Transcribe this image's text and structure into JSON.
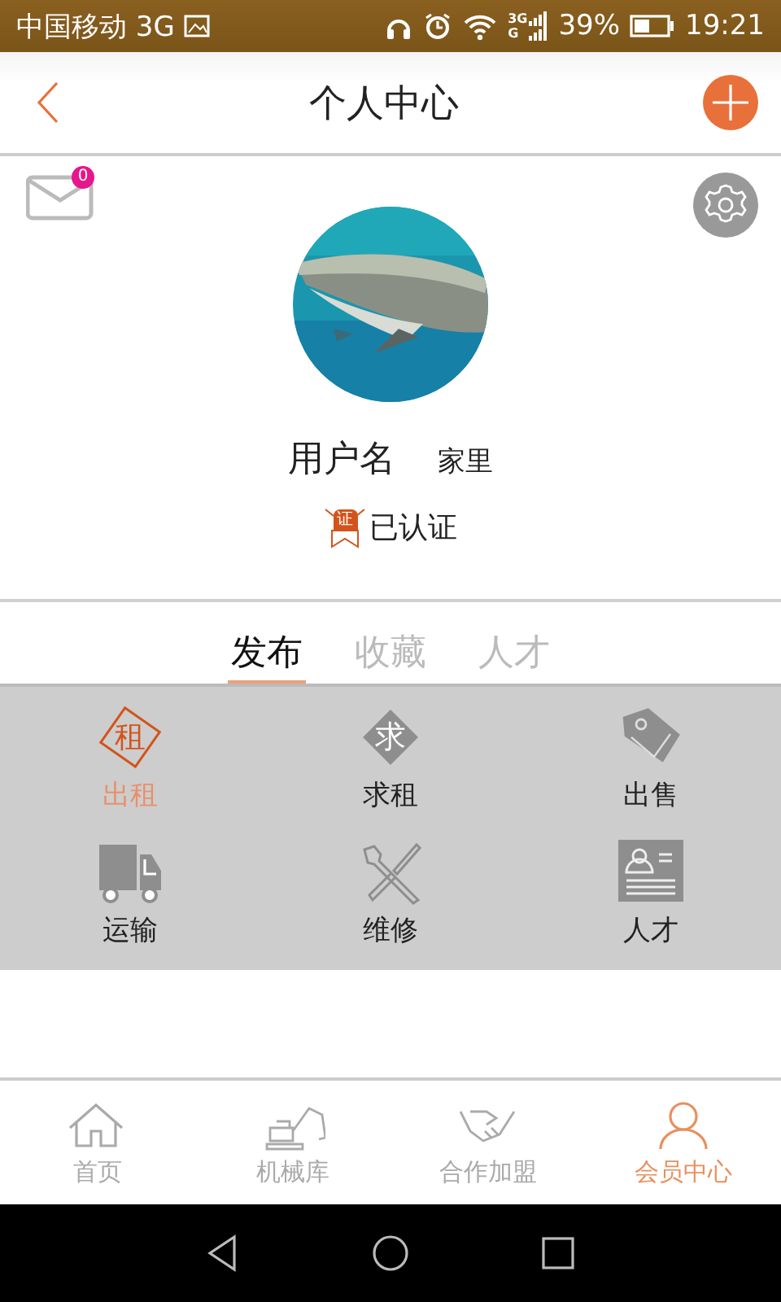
{
  "status_bar": {
    "carrier": "中国移动 3G",
    "network_labels": [
      "3G",
      "G"
    ],
    "battery": "39%",
    "time": "19:21"
  },
  "header": {
    "title": "个人中心"
  },
  "profile": {
    "message_count": "0",
    "username_label": "用户名",
    "username": "家里",
    "verified": true,
    "verified_glyph": "证",
    "verified_label": "已认证"
  },
  "tabs": [
    {
      "label": "发布",
      "selected": true
    },
    {
      "label": "收藏",
      "selected": false
    },
    {
      "label": "人才",
      "selected": false
    }
  ],
  "actions": [
    {
      "kind": "rent",
      "glyph": "租",
      "label": "出租",
      "selected": true
    },
    {
      "kind": "seek",
      "glyph": "求",
      "label": "求租",
      "selected": false
    },
    {
      "kind": "sale",
      "label": "出售",
      "selected": false
    },
    {
      "kind": "truck",
      "label": "运输",
      "selected": false
    },
    {
      "kind": "repair",
      "label": "维修",
      "selected": false
    },
    {
      "kind": "resume",
      "label": "人才",
      "selected": false
    }
  ],
  "bottom_nav": [
    {
      "kind": "home",
      "label": "首页",
      "selected": false
    },
    {
      "kind": "excavator",
      "label": "机械库",
      "selected": false
    },
    {
      "kind": "handshake",
      "label": "合作加盟",
      "selected": false
    },
    {
      "kind": "member",
      "label": "会员中心",
      "selected": true
    }
  ]
}
